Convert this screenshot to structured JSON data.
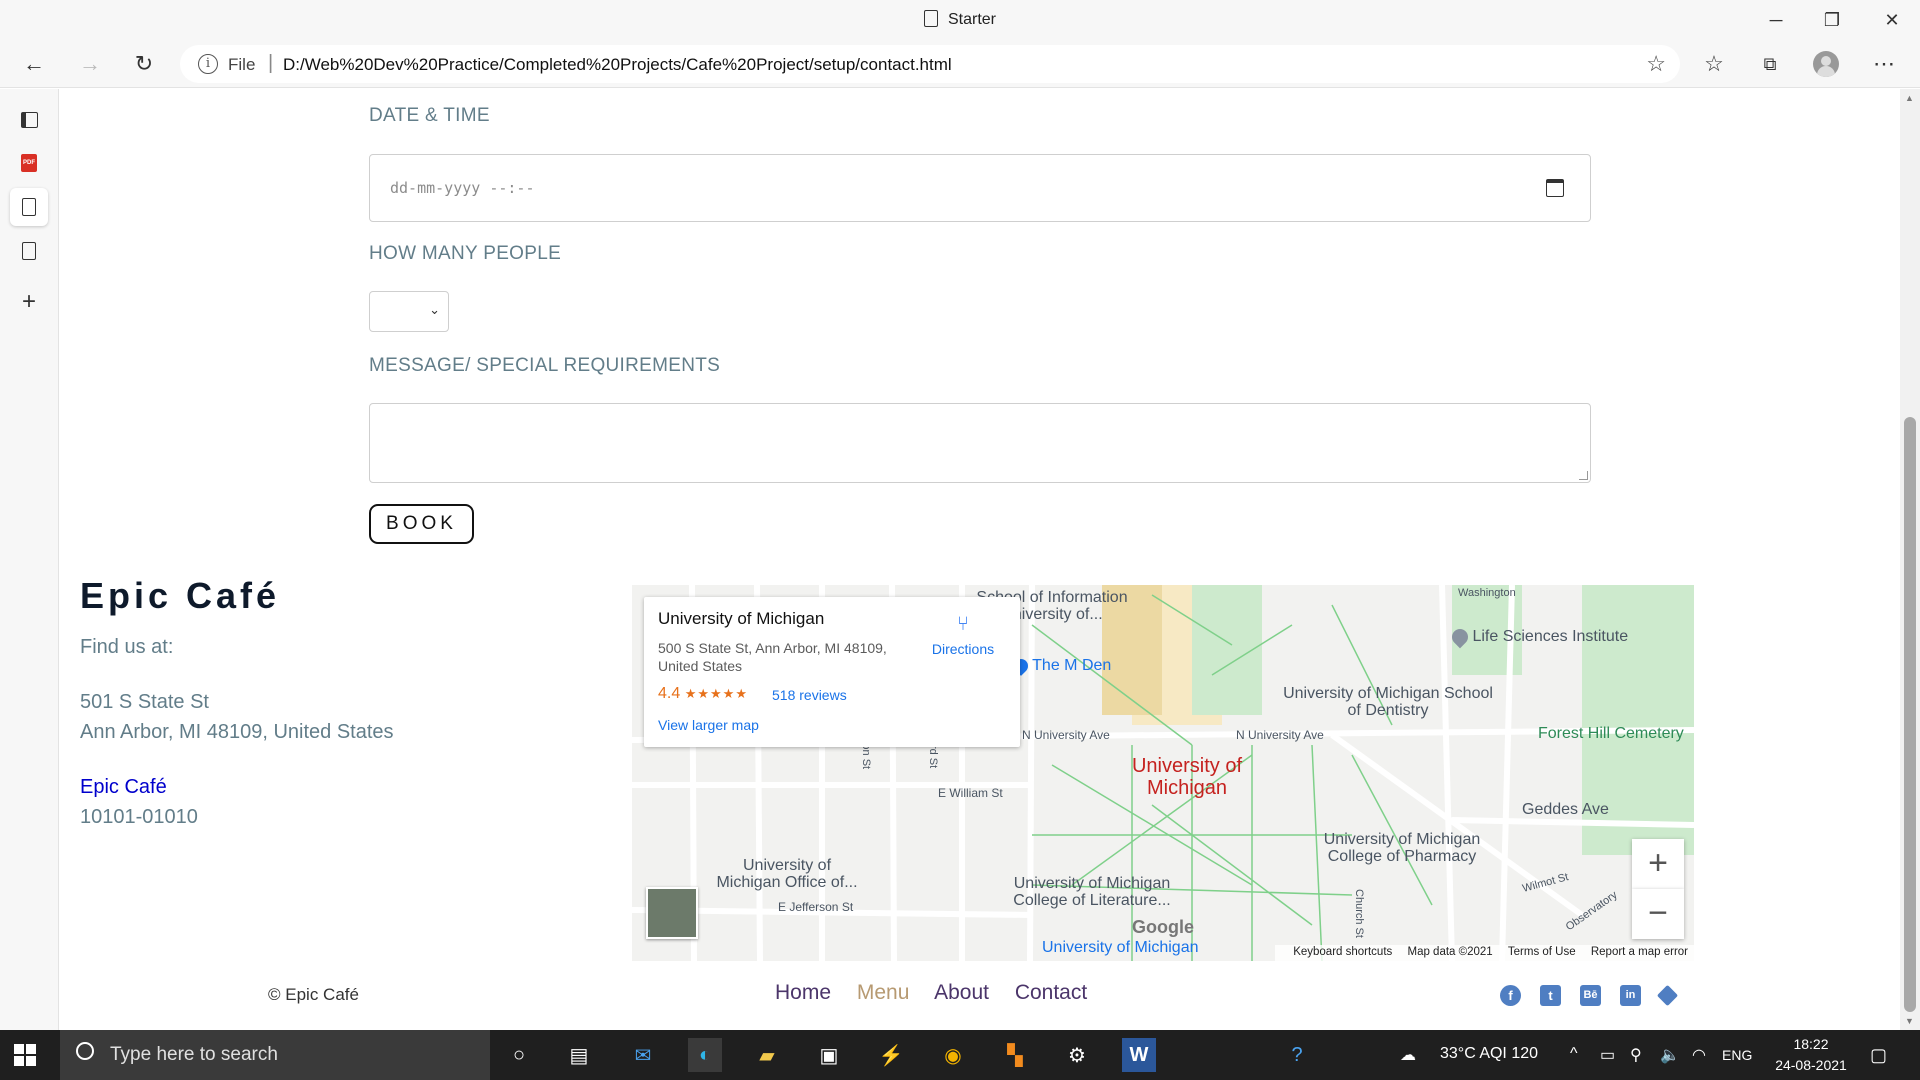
{
  "window": {
    "title": "Starter"
  },
  "address_bar": {
    "scheme_label": "File",
    "url": "D:/Web%20Dev%20Practice/Completed%20Projects/Cafe%20Project/setup/contact.html"
  },
  "form": {
    "datetime_label": "DATE & TIME",
    "datetime_placeholder": "dd-mm-yyyy --:--",
    "people_label": "HOW MANY PEOPLE",
    "message_label": "MESSAGE/ SPECIAL REQUIREMENTS",
    "book_button": "BOOK"
  },
  "contact": {
    "brand": "Epic Café",
    "find_us": "Find us at:",
    "address_line1": "501 S State St",
    "address_line2": "Ann Arbor, MI 48109, United States",
    "link_text": "Epic Café",
    "phone": "10101-01010"
  },
  "map": {
    "place_name": "University of Michigan",
    "place_address": "500 S State St, Ann Arbor, MI 48109, United States",
    "rating": "4.4",
    "stars": "★★★★★",
    "reviews": "518 reviews",
    "view_larger": "View larger map",
    "directions": "Directions",
    "labels": {
      "school_info": "School of Information University of...",
      "life_sciences": "Life Sciences Institute",
      "m_den": "The M Den",
      "dentistry": "University of Michigan School of Dentistry",
      "n_univ_ave_1": "N University Ave",
      "n_univ_ave_2": "N University Ave",
      "forest_hill": "Forest Hill Cemetery",
      "univ_big": "University of Michigan",
      "e_william": "E William St",
      "geddes": "Geddes Ave",
      "pharmacy": "University of Michigan College of Pharmacy",
      "office": "University of Michigan Office of...",
      "literature": "University of Michigan College of Literature...",
      "jefferson": "E Jefferson St",
      "univ_bottom": "University of Michigan",
      "washington": "Washington",
      "church": "Church St",
      "wilmot": "Wilmot St",
      "observatory": "Observatory",
      "state_a": "son St",
      "state_b": "ard St"
    },
    "google": "Google",
    "attribution": {
      "shortcuts": "Keyboard shortcuts",
      "data": "Map data ©2021",
      "terms": "Terms of Use",
      "report": "Report a map error"
    },
    "zoom_in": "+",
    "zoom_out": "−"
  },
  "footer": {
    "copyright": "© Epic Café",
    "nav": [
      "Home",
      "Menu",
      "About",
      "Contact"
    ],
    "social": [
      "facebook-icon",
      "twitter-icon",
      "behance-icon",
      "linkedin-icon",
      "diamond-icon"
    ]
  },
  "taskbar": {
    "search_placeholder": "Type here to search",
    "weather": "33°C  AQI 120",
    "language": "ENG",
    "time": "18:22",
    "date": "24-08-2021"
  },
  "colors": {
    "label": "#627d89",
    "brand": "#0e1a2b",
    "nav": "#4b356a",
    "nav_active": "#b79a72",
    "link": "#0000cc"
  }
}
